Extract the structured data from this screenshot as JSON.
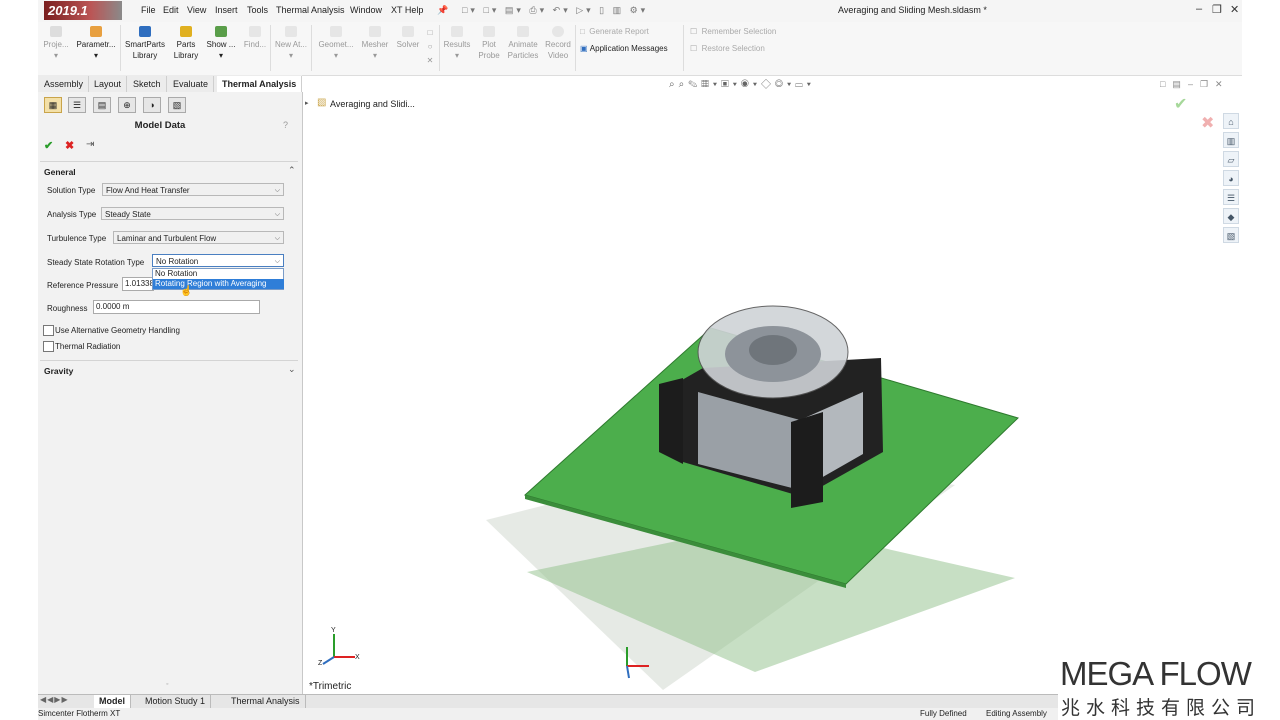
{
  "app": {
    "logo_text": "2019.1",
    "document_title": "Averaging and Sliding Mesh.sldasm *"
  },
  "menu": [
    "File",
    "Edit",
    "View",
    "Insert",
    "Tools",
    "Thermal Analysis",
    "Window",
    "XT Help"
  ],
  "ribbon": {
    "buttons": [
      {
        "label": "Proje...",
        "enabled": false
      },
      {
        "label": "Parametr...",
        "enabled": true
      },
      {
        "label": "SmartParts\nLibrary",
        "enabled": true
      },
      {
        "label": "Parts\nLibrary",
        "enabled": true
      },
      {
        "label": "Show ...",
        "enabled": true
      },
      {
        "label": "Find...",
        "enabled": false
      },
      {
        "label": "New At...",
        "enabled": false
      },
      {
        "label": "Geomet...",
        "enabled": false
      },
      {
        "label": "Mesher",
        "enabled": false
      },
      {
        "label": "Solver",
        "enabled": false
      },
      {
        "label": "Results",
        "enabled": false
      },
      {
        "label": "Plot\nProbe",
        "enabled": false
      },
      {
        "label": "Animate\nParticles",
        "enabled": false
      },
      {
        "label": "Record\nVideo",
        "enabled": false
      }
    ],
    "generate_report": "Generate Report",
    "application_messages": "Application Messages",
    "remember_selection": "Remember Selection",
    "restore_selection": "Restore Selection"
  },
  "tabs": [
    {
      "label": "Assembly",
      "active": false
    },
    {
      "label": "Layout",
      "active": false
    },
    {
      "label": "Sketch",
      "active": false
    },
    {
      "label": "Evaluate",
      "active": false
    },
    {
      "label": "Thermal Analysis",
      "active": true
    }
  ],
  "panel": {
    "title": "Model Data",
    "help": "?",
    "general_header": "General",
    "fields": {
      "solution_type": {
        "label": "Solution Type",
        "value": "Flow And Heat Transfer"
      },
      "analysis_type": {
        "label": "Analysis Type",
        "value": "Steady State"
      },
      "turbulence_type": {
        "label": "Turbulence Type",
        "value": "Laminar and Turbulent Flow"
      },
      "rotation_type": {
        "label": "Steady State Rotation Type",
        "value": "No Rotation"
      },
      "reference_pressure": {
        "label": "Reference Pressure",
        "value": "1.01338"
      },
      "roughness": {
        "label": "Roughness",
        "value": "0.0000 m"
      }
    },
    "rotation_options": [
      "No Rotation",
      "Rotating Region with Averaging"
    ],
    "checkboxes": [
      {
        "label": "Use Alternative Geometry Handling",
        "checked": false
      },
      {
        "label": "Thermal Radiation",
        "checked": false
      }
    ],
    "gravity_header": "Gravity"
  },
  "viewport": {
    "tree_root": "Averaging and Slidi...",
    "view_label": "*Trimetric",
    "axes": {
      "x": "X",
      "y": "Y",
      "z": "Z"
    }
  },
  "bottom_tabs": [
    {
      "label": "Model",
      "active": true
    },
    {
      "label": "Motion Study 1",
      "active": false
    },
    {
      "label": "Thermal Analysis",
      "active": false
    }
  ],
  "status": {
    "left": "Simcenter Flotherm XT",
    "fully_defined": "Fully Defined",
    "editing": "Editing Assembly"
  },
  "watermark": {
    "en": "MEGA FLOW",
    "zh": "兆水科技有限公司"
  },
  "colors": {
    "board": "#4cae4c",
    "selection": "#2f7ed8",
    "active_tab_bg": "#ffffff"
  }
}
